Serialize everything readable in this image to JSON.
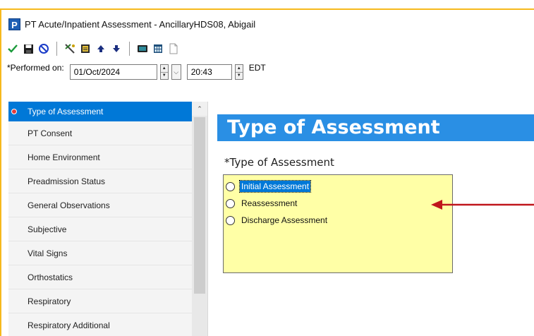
{
  "window": {
    "app_icon_letter": "P",
    "title": "PT Acute/Inpatient Assessment - AncillaryHDS08, Abigail"
  },
  "toolbar": {
    "icons": [
      "check-icon",
      "save-icon",
      "cancel-icon",
      "tools-icon",
      "form-icon",
      "up-arrow-icon",
      "down-arrow-icon",
      "monitor-icon",
      "calendar-icon",
      "document-icon"
    ]
  },
  "performed": {
    "label": "*Performed on:",
    "date": "01/Oct/2024",
    "time": "20:43",
    "timezone": "EDT"
  },
  "nav": {
    "items": [
      {
        "label": "Type of Assessment",
        "selected": true
      },
      {
        "label": "PT Consent"
      },
      {
        "label": "Home Environment"
      },
      {
        "label": "Preadmission Status"
      },
      {
        "label": "General Observations"
      },
      {
        "label": "Subjective"
      },
      {
        "label": "Vital Signs"
      },
      {
        "label": "Orthostatics"
      },
      {
        "label": "Respiratory"
      },
      {
        "label": "Respiratory Additional"
      }
    ]
  },
  "content": {
    "section_title": "Type of Assessment",
    "question_label": "*Type of Assessment",
    "options": [
      {
        "label": "Initial Assessment"
      },
      {
        "label": "Reassessment"
      },
      {
        "label": "Discharge Assessment"
      }
    ]
  },
  "colors": {
    "accent_blue": "#2a8fe4",
    "selection_blue": "#0078d7",
    "answer_box_yellow": "#ffffa6",
    "frame_orange": "#f6b91d",
    "arrow_red": "#c0161c"
  }
}
